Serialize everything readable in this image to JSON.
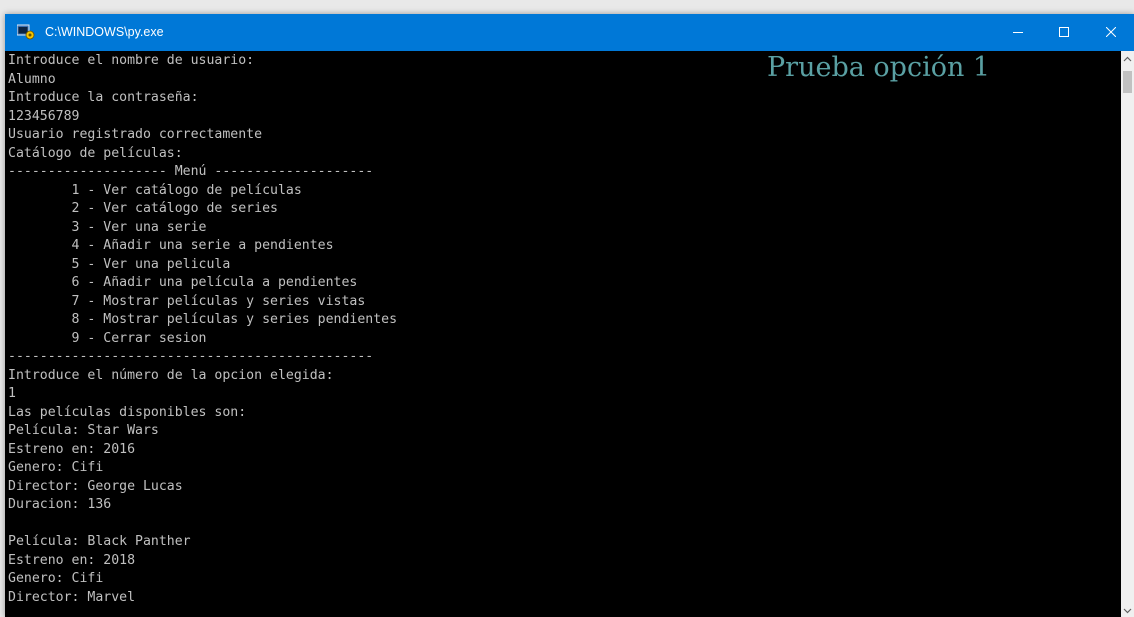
{
  "window": {
    "title": "C:\\WINDOWS\\py.exe",
    "colors": {
      "titlebar": "#0078d7",
      "console_bg": "#000000",
      "console_text": "#c0c0c0",
      "note_text": "#5aa0a3"
    },
    "icons": {
      "app": "python-launcher-icon",
      "minimize": "minimize-icon",
      "maximize": "maximize-icon",
      "close": "close-icon"
    }
  },
  "note": {
    "text": "Prueba opción 1"
  },
  "console": {
    "lines": [
      "Introduce el nombre de usuario:",
      "Alumno",
      "Introduce la contraseña:",
      "123456789",
      "Usuario registrado correctamente",
      "Catálogo de películas:",
      "-------------------- Menú --------------------",
      "        1 - Ver catálogo de películas",
      "        2 - Ver catálogo de series",
      "        3 - Ver una serie",
      "        4 - Añadir una serie a pendientes",
      "        5 - Ver una pelicula",
      "        6 - Añadir una película a pendientes",
      "        7 - Mostrar películas y series vistas",
      "        8 - Mostrar películas y series pendientes",
      "        9 - Cerrar sesion",
      "----------------------------------------------",
      "Introduce el número de la opcion elegida:",
      "1",
      "Las películas disponibles son:",
      "Película: Star Wars",
      "Estreno en: 2016",
      "Genero: Cifi",
      "Director: George Lucas",
      "Duracion: 136",
      "",
      "Película: Black Panther",
      "Estreno en: 2018",
      "Genero: Cifi",
      "Director: Marvel"
    ]
  },
  "scrollbar": {
    "up_icon": "scroll-up-arrow-icon",
    "down_icon": "scroll-down-arrow-icon"
  }
}
